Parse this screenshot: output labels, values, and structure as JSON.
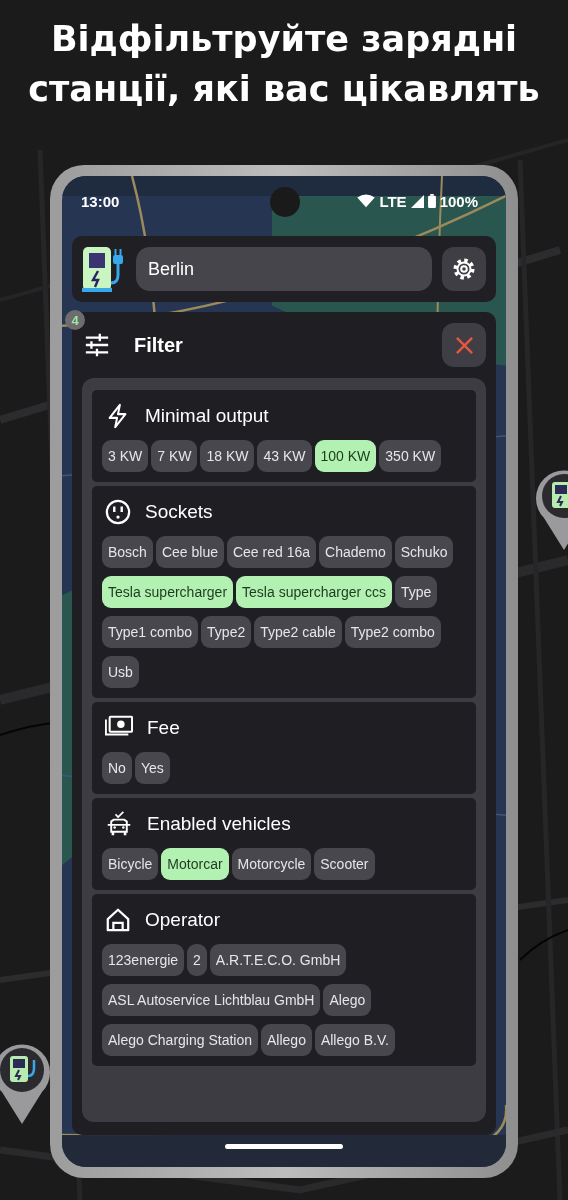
{
  "headline_lines": [
    "Відфільтруйте зарядні",
    "станції, які вас цікавлять"
  ],
  "status_bar": {
    "time": "13:00",
    "network": "LTE",
    "battery": "100%"
  },
  "search": {
    "value": "Berlin"
  },
  "filter": {
    "title": "Filter",
    "badge": "4",
    "sections": [
      {
        "title": "Minimal output",
        "kind": "bolt",
        "chips": [
          {
            "label": "3 KW",
            "selected": false
          },
          {
            "label": "7 KW",
            "selected": false
          },
          {
            "label": "18 KW",
            "selected": false
          },
          {
            "label": "43 KW",
            "selected": false
          },
          {
            "label": "100 KW",
            "selected": true
          },
          {
            "label": "350 KW",
            "selected": false
          }
        ]
      },
      {
        "title": "Sockets",
        "kind": "socket",
        "chips": [
          {
            "label": "Bosch",
            "selected": false
          },
          {
            "label": "Cee blue",
            "selected": false
          },
          {
            "label": "Cee red 16a",
            "selected": false
          },
          {
            "label": "Chademo",
            "selected": false
          },
          {
            "label": "Schuko",
            "selected": false
          },
          {
            "label": "Tesla supercharger",
            "selected": true
          },
          {
            "label": "Tesla supercharger ccs",
            "selected": true
          },
          {
            "label": "Type",
            "selected": false
          },
          {
            "label": "Type1 combo",
            "selected": false
          },
          {
            "label": "Type2",
            "selected": false
          },
          {
            "label": "Type2 cable",
            "selected": false
          },
          {
            "label": "Type2 combo",
            "selected": false
          },
          {
            "label": "Usb",
            "selected": false
          }
        ]
      },
      {
        "title": "Fee",
        "kind": "money",
        "chips": [
          {
            "label": "No",
            "selected": false
          },
          {
            "label": "Yes",
            "selected": false
          }
        ]
      },
      {
        "title": "Enabled vehicles",
        "kind": "car",
        "chips": [
          {
            "label": "Bicycle",
            "selected": false
          },
          {
            "label": "Motorcar",
            "selected": true
          },
          {
            "label": "Motorcycle",
            "selected": false
          },
          {
            "label": "Scooter",
            "selected": false
          }
        ]
      },
      {
        "title": "Operator",
        "kind": "home",
        "chips": [
          {
            "label": "123energie",
            "selected": false
          },
          {
            "label": "2",
            "selected": false
          },
          {
            "label": "A.R.T.E.C.O. GmbH",
            "selected": false
          },
          {
            "label": "ASL Autoservice Lichtblau GmbH",
            "selected": false
          },
          {
            "label": "Alego",
            "selected": false
          },
          {
            "label": "Alego Charging Station",
            "selected": false
          },
          {
            "label": "Allego",
            "selected": false
          },
          {
            "label": "Allego B.V.",
            "selected": false
          }
        ]
      }
    ]
  }
}
